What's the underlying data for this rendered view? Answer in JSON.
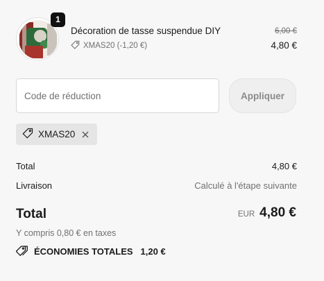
{
  "line_item": {
    "quantity": "1",
    "title": "Décoration de tasse suspendue DIY",
    "discount": "XMAS20 (-1,20 €)",
    "original_price": "6,00 €",
    "price": "4,80 €",
    "icons": {
      "discount": "tag-icon"
    }
  },
  "discount_form": {
    "placeholder": "Code de réduction",
    "value": "",
    "apply_label": "Appliquer"
  },
  "applied_code": {
    "code": "XMAS20",
    "icons": {
      "tag": "tag-icon",
      "remove": "close-icon"
    }
  },
  "summary": {
    "subtotal_label": "Total",
    "subtotal_value": "4,80 €",
    "shipping_label": "Livraison",
    "shipping_value": "Calculé à l'étape suivante",
    "total_label": "Total",
    "currency": "EUR",
    "total_value": "4,80 €",
    "taxes_note": "Y compris 0,80 € en taxes",
    "savings_label": "ÉCONOMIES TOTALES",
    "savings_value": "1,20 €",
    "icons": {
      "savings": "tags-icon"
    }
  },
  "colors": {
    "background": "#f7f7f7",
    "text": "#1a1a1a",
    "muted": "#707070",
    "chip": "#e5e5e5",
    "badge": "#111111"
  }
}
